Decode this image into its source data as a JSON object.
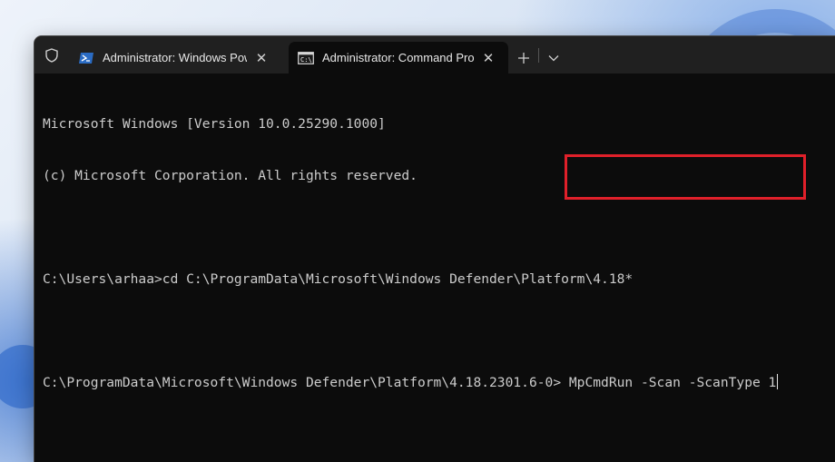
{
  "tabs": [
    {
      "label": "Administrator: Windows PowerShell",
      "icon": "powershell-icon",
      "active": false
    },
    {
      "label": "Administrator: Command Prompt",
      "icon": "cmd-icon",
      "active": true
    }
  ],
  "toolbar": {
    "new_tab": "+",
    "dropdown": "⌄"
  },
  "terminal": {
    "lines": [
      "Microsoft Windows [Version 10.0.25290.1000]",
      "(c) Microsoft Corporation. All rights reserved.",
      "",
      "C:\\Users\\arhaa>cd C:\\ProgramData\\Microsoft\\Windows Defender\\Platform\\4.18*",
      ""
    ],
    "prompt": "C:\\ProgramData\\Microsoft\\Windows Defender\\Platform\\4.18.2301.6-0>",
    "command": " MpCmdRun -Scan -ScanType 1"
  },
  "colors": {
    "terminal_bg": "#0c0c0c",
    "titlebar_bg": "#202020",
    "text": "#cccccc",
    "highlight": "#e0202a"
  }
}
